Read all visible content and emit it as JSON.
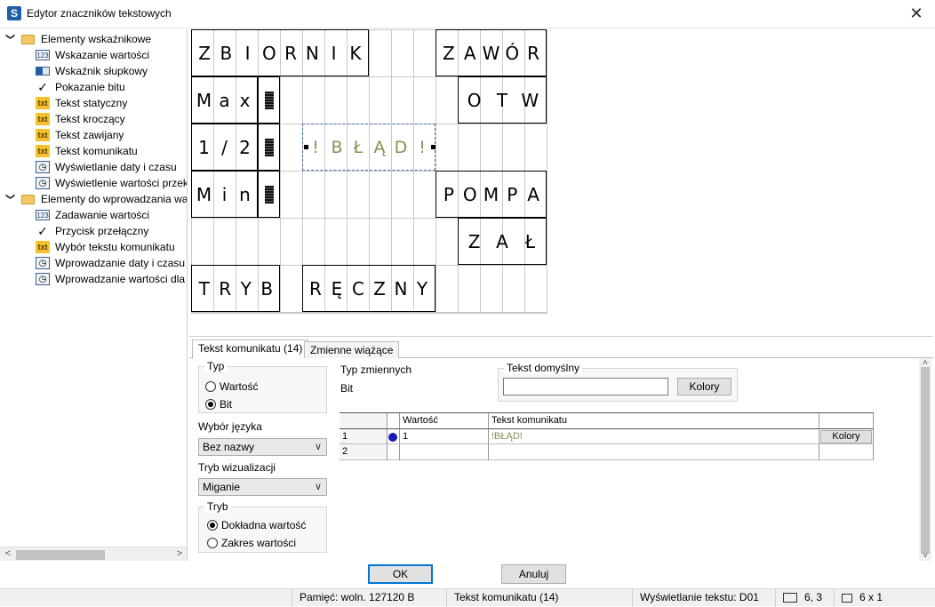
{
  "window": {
    "title": "Edytor znaczników tekstowych"
  },
  "tree": {
    "groups": [
      {
        "label": "Elementy wskaźnikowe",
        "items": [
          {
            "label": "Wskazanie wartości",
            "icon": "numeric-display-icon"
          },
          {
            "label": "Wskaźnik słupkowy",
            "icon": "bar-indicator-icon"
          },
          {
            "label": "Pokazanie bitu",
            "icon": "checkmark-icon"
          },
          {
            "label": "Tekst statyczny",
            "icon": "static-text-icon"
          },
          {
            "label": "Tekst kroczący",
            "icon": "scrolling-text-icon"
          },
          {
            "label": "Tekst zawijany",
            "icon": "wrapped-text-icon"
          },
          {
            "label": "Tekst komunikatu",
            "icon": "message-text-icon"
          },
          {
            "label": "Wyświetlanie daty i czasu",
            "icon": "datetime-icon"
          },
          {
            "label": "Wyświetlenie wartości przeka",
            "icon": "datetime-icon"
          }
        ]
      },
      {
        "label": "Elementy do wprowadzania war",
        "items": [
          {
            "label": "Zadawanie wartości",
            "icon": "numeric-input-icon"
          },
          {
            "label": "Przycisk przełączny",
            "icon": "toggle-button-icon"
          },
          {
            "label": "Wybór tekstu komunikatu",
            "icon": "message-select-icon"
          },
          {
            "label": "Wprowadzanie daty i czasu",
            "icon": "datetime-input-icon"
          },
          {
            "label": "Wprowadzanie wartości dla p",
            "icon": "datetime-input-icon"
          }
        ]
      }
    ]
  },
  "grid": {
    "fields": [
      {
        "id": "zbiornik",
        "chars": [
          "Z",
          "B",
          "I",
          "O",
          "R",
          "N",
          "I",
          "K"
        ]
      },
      {
        "id": "zawor",
        "chars": [
          "Z",
          "A",
          "W",
          "Ó",
          "R"
        ]
      },
      {
        "id": "max",
        "chars": [
          "M",
          "a",
          "x"
        ]
      },
      {
        "id": "otw",
        "chars": [
          "O",
          "T",
          "W"
        ]
      },
      {
        "id": "half",
        "chars": [
          "1",
          "/",
          "2"
        ]
      },
      {
        "id": "blad",
        "chars": [
          "!",
          "B",
          "Ł",
          "Ą",
          "D",
          "!"
        ]
      },
      {
        "id": "min",
        "chars": [
          "M",
          "i",
          "n"
        ]
      },
      {
        "id": "pompa",
        "chars": [
          "P",
          "O",
          "M",
          "P",
          "A"
        ]
      },
      {
        "id": "zal",
        "chars": [
          "Z",
          "A",
          "Ł"
        ]
      },
      {
        "id": "tryb",
        "chars": [
          "T",
          "R",
          "Y",
          "B"
        ]
      },
      {
        "id": "reczny",
        "chars": [
          "R",
          "Ę",
          "C",
          "Z",
          "N",
          "Y"
        ]
      }
    ]
  },
  "tabs": [
    {
      "label": "Tekst komunikatu (14)"
    },
    {
      "label": "Zmienne wiążące"
    }
  ],
  "typ": {
    "title": "Typ",
    "options": [
      {
        "label": "Wartość",
        "selected": false
      },
      {
        "label": "Bit",
        "selected": true
      }
    ]
  },
  "typ_zmiennych": {
    "label": "Typ zmiennych",
    "value": "Bit"
  },
  "tekst_domyslny": {
    "title": "Tekst domyślny",
    "value": "",
    "button": "Kolory"
  },
  "wybor_jezyka": {
    "label": "Wybór języka",
    "value": "Bez nazwy"
  },
  "tryb_wizualizacji": {
    "label": "Tryb wizualizacji",
    "value": "Miganie"
  },
  "tryb": {
    "title": "Tryb",
    "options": [
      {
        "label": "Dokładna wartość",
        "selected": true
      },
      {
        "label": "Zakres wartości",
        "selected": false
      }
    ]
  },
  "table": {
    "headers": [
      "Wartość",
      "Tekst komunikatu"
    ],
    "rows": [
      {
        "num": "1",
        "value": "1",
        "text": "!BŁĄD!",
        "button": "Kolory",
        "dot_color": "#1a1ab8"
      },
      {
        "num": "2",
        "value": "",
        "text": "",
        "button": ""
      }
    ]
  },
  "buttons": {
    "ok": "OK",
    "cancel": "Anuluj"
  },
  "status": {
    "memory": "Pamięć: woln. 127120 B",
    "element": "Tekst komunikatu (14)",
    "display": "Wyświetlanie tekstu: D01",
    "position": "6,  3",
    "size": "6 x  1"
  },
  "colors": {
    "accent": "#0078d7",
    "blink_text": "#8d8d55",
    "dot": "#1a1ab8"
  }
}
